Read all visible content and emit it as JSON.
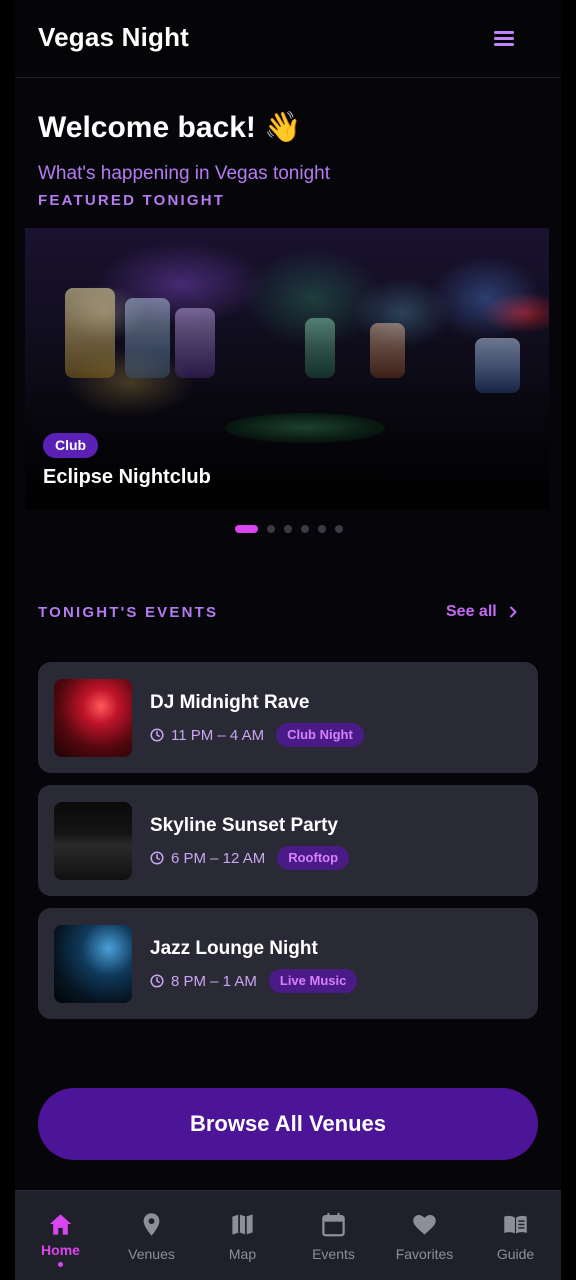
{
  "app": {
    "title": "Vegas Night"
  },
  "welcome": {
    "title": "Welcome back! 👋",
    "subtitle": "What's happening in Vegas tonight"
  },
  "featured": {
    "label": "FEATURED TONIGHT",
    "slide": {
      "category": "Club",
      "title": "Eclipse Nightclub"
    },
    "slides_total": 6,
    "active_slide": 1
  },
  "events": {
    "label": "TONIGHT'S EVENTS",
    "see_all": "See all",
    "items": [
      {
        "title": "DJ Midnight Rave",
        "time": "11 PM – 4 AM",
        "tag": "Club Night"
      },
      {
        "title": "Skyline Sunset Party",
        "time": "6 PM – 12 AM",
        "tag": "Rooftop"
      },
      {
        "title": "Jazz Lounge Night",
        "time": "8 PM – 1 AM",
        "tag": "Live Music"
      }
    ]
  },
  "browse_button": "Browse All Venues",
  "nav": {
    "items": [
      {
        "label": "Home",
        "icon": "home-icon",
        "active": true
      },
      {
        "label": "Venues",
        "icon": "map-pin-icon"
      },
      {
        "label": "Map",
        "icon": "map-icon"
      },
      {
        "label": "Events",
        "icon": "calendar-icon"
      },
      {
        "label": "Favorites",
        "icon": "heart-icon"
      },
      {
        "label": "Guide",
        "icon": "book-icon"
      }
    ]
  },
  "colors": {
    "accent": "#d946ef",
    "purple_text": "#b57bf0",
    "button": "#4c1496",
    "card": "#2a2a36",
    "tag_bg": "#4a1b86"
  }
}
